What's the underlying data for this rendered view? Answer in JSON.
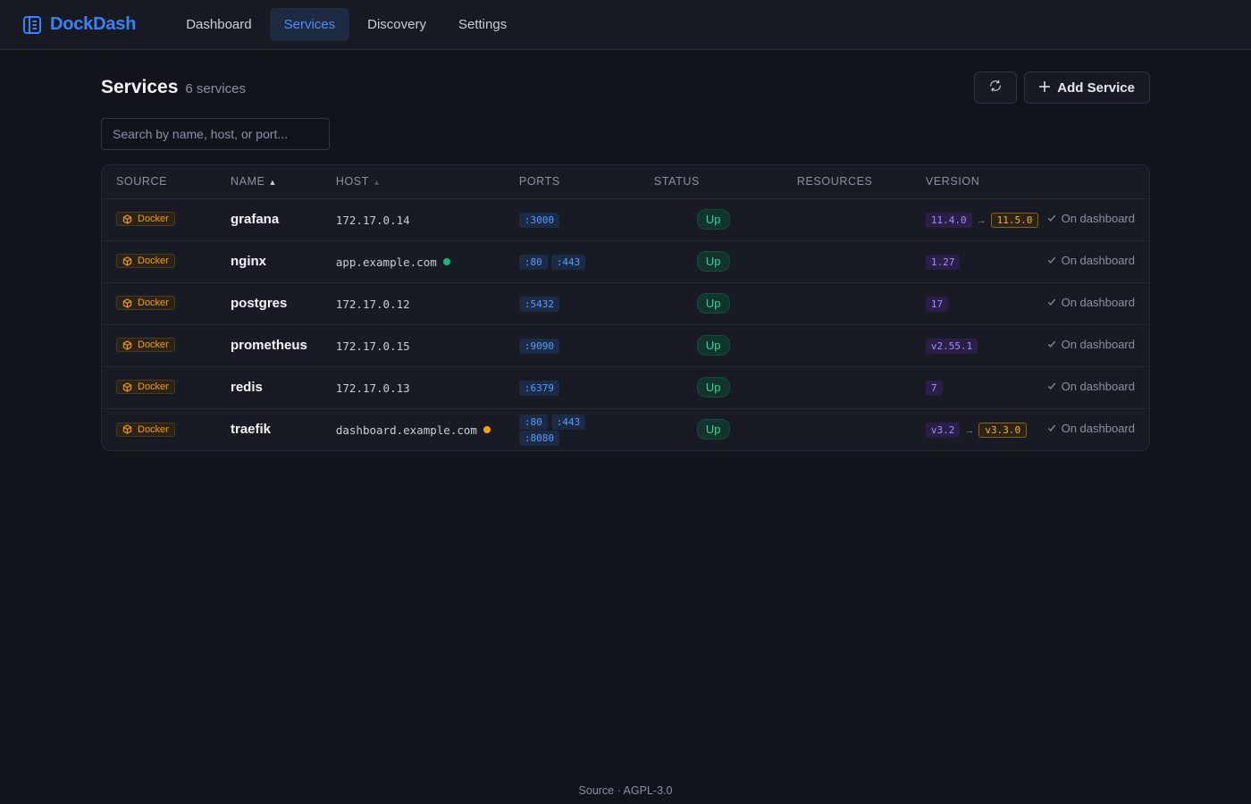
{
  "app": {
    "name": "DockDash",
    "nav": [
      {
        "label": "Dashboard",
        "active": false
      },
      {
        "label": "Services",
        "active": true
      },
      {
        "label": "Discovery",
        "active": false
      },
      {
        "label": "Settings",
        "active": false
      }
    ]
  },
  "page": {
    "title": "Services",
    "count_label": "6 services",
    "add_button": "Add Service",
    "add_icon": "plus-icon",
    "refresh_icon": "refresh-icon",
    "search_placeholder": "Search by name, host, or port..."
  },
  "table": {
    "columns": [
      "SOURCE",
      "NAME",
      "HOST",
      "PORTS",
      "STATUS",
      "RESOURCES",
      "VERSION"
    ],
    "sort": {
      "column": "NAME",
      "direction": "asc"
    },
    "rows": [
      {
        "source": "Docker",
        "name": "grafana",
        "host": "172.17.0.14",
        "host_dot": null,
        "ports": [
          ":3000"
        ],
        "status": "Up",
        "resources": "",
        "version": "11.4.0",
        "update": "11.5.0",
        "dashboard": "On dashboard"
      },
      {
        "source": "Docker",
        "name": "nginx",
        "host": "app.example.com",
        "host_dot": "#10b981",
        "ports": [
          ":80",
          ":443"
        ],
        "status": "Up",
        "resources": "",
        "version": "1.27",
        "update": null,
        "dashboard": "On dashboard"
      },
      {
        "source": "Docker",
        "name": "postgres",
        "host": "172.17.0.12",
        "host_dot": null,
        "ports": [
          ":5432"
        ],
        "status": "Up",
        "resources": "",
        "version": "17",
        "update": null,
        "dashboard": "On dashboard"
      },
      {
        "source": "Docker",
        "name": "prometheus",
        "host": "172.17.0.15",
        "host_dot": null,
        "ports": [
          ":9090"
        ],
        "status": "Up",
        "resources": "",
        "version": "v2.55.1",
        "update": null,
        "dashboard": "On dashboard"
      },
      {
        "source": "Docker",
        "name": "redis",
        "host": "172.17.0.13",
        "host_dot": null,
        "ports": [
          ":6379"
        ],
        "status": "Up",
        "resources": "",
        "version": "7",
        "update": null,
        "dashboard": "On dashboard"
      },
      {
        "source": "Docker",
        "name": "traefik",
        "host": "dashboard.example.com",
        "host_dot": "#f59e0b",
        "ports": [
          ":80",
          ":443",
          ":8080"
        ],
        "status": "Up",
        "resources": "",
        "version": "v3.2",
        "update": "v3.3.0",
        "dashboard": "On dashboard"
      }
    ]
  },
  "footer": {
    "text": "Source · AGPL-3.0"
  },
  "colors": {
    "accent": "#3b82f6",
    "status_up": "#34d399",
    "docker": "#f59e0b",
    "version": "#a78bfa"
  }
}
